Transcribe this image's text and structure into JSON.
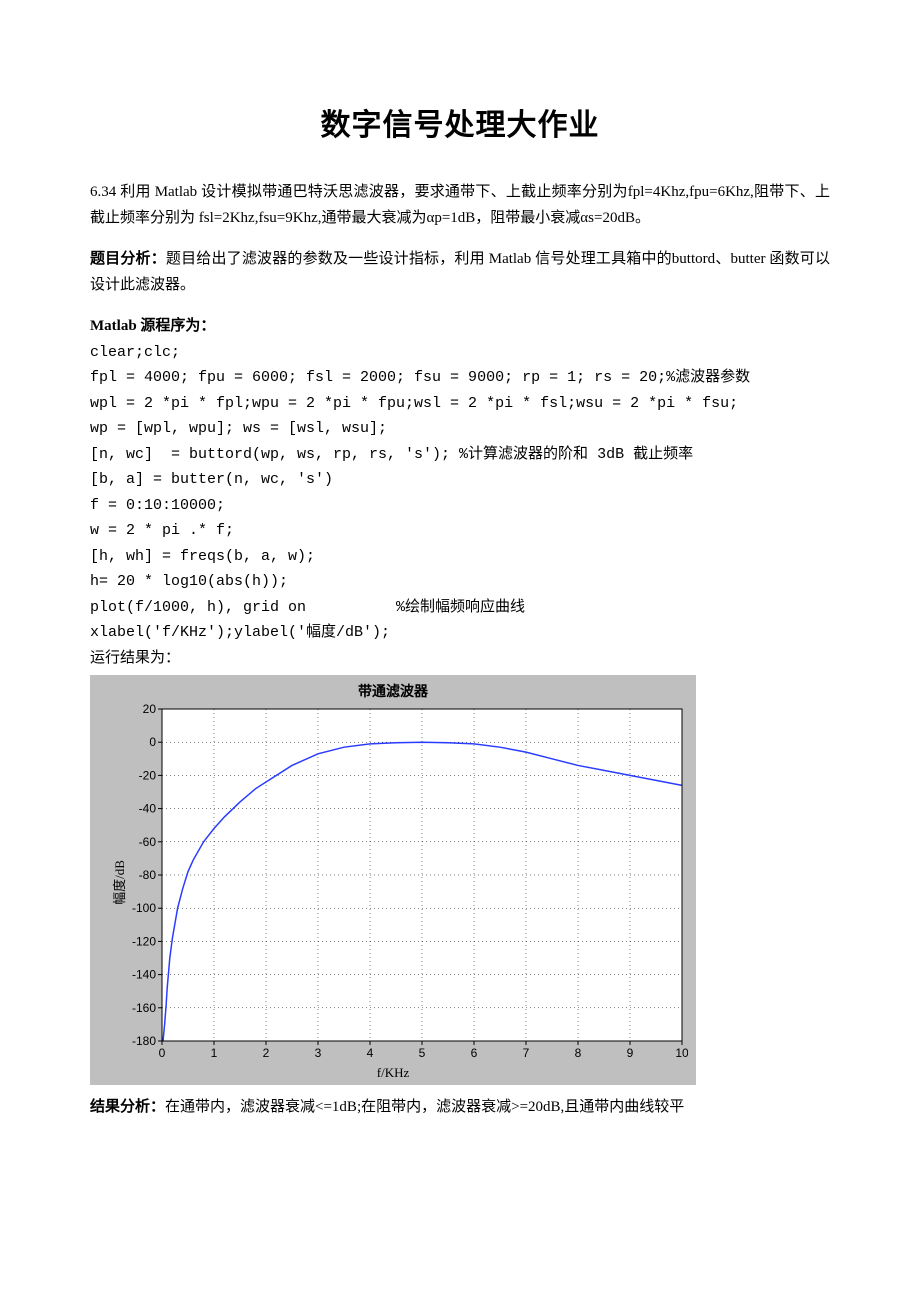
{
  "title": "数字信号处理大作业",
  "problem": "6.34   利用 Matlab 设计模拟带通巴特沃思滤波器，要求通带下、上截止频率分别为fpl=4Khz,fpu=6Khz,阻带下、上截止频率分别为 fsl=2Khz,fsu=9Khz,通带最大衰减为αp=1dB，阻带最小衰减αs=20dB。",
  "analysis_label": "题目分析：",
  "analysis_text": "题目给出了滤波器的参数及一些设计指标，利用 Matlab 信号处理工具箱中的buttord、butter 函数可以设计此滤波器。",
  "source_label": "Matlab 源程序为：",
  "code_lines": [
    "clear;clc;",
    "fpl = 4000; fpu = 6000; fsl = 2000; fsu = 9000; rp = 1; rs = 20;%滤波器参数",
    "wpl = 2 *pi * fpl;wpu = 2 *pi * fpu;wsl = 2 *pi * fsl;wsu = 2 *pi * fsu;",
    "wp = [wpl, wpu]; ws = [wsl, wsu];",
    "[n, wc]  = buttord(wp, ws, rp, rs, 's'); %计算滤波器的阶和 3dB 截止频率",
    "[b, a] = butter(n, wc, 's')",
    "f = 0:10:10000;",
    "w = 2 * pi .* f;",
    "[h, wh] = freqs(b, a, w);",
    "h= 20 * log10(abs(h));",
    "plot(f/1000, h), grid on          %绘制幅频响应曲线",
    "xlabel('f/KHz');ylabel('幅度/dB');",
    "运行结果为："
  ],
  "result_label": "结果分析：",
  "result_text": "在通带内，滤波器衰减<=1dB;在阻带内，滤波器衰减>=20dB,且通带内曲线较平",
  "chart_data": {
    "type": "line",
    "title": "带通滤波器",
    "xlabel": "f/KHz",
    "ylabel": "幅度/dB",
    "xlim": [
      0,
      10
    ],
    "ylim": [
      -180,
      20
    ],
    "xticks": [
      0,
      1,
      2,
      3,
      4,
      5,
      6,
      7,
      8,
      9,
      10
    ],
    "yticks": [
      20,
      0,
      -20,
      -40,
      -60,
      -80,
      -100,
      -120,
      -140,
      -160,
      -180
    ],
    "series": [
      {
        "name": "magnitude",
        "color": "#2a3cff",
        "x": [
          0.02,
          0.05,
          0.08,
          0.1,
          0.15,
          0.2,
          0.3,
          0.4,
          0.5,
          0.6,
          0.8,
          1.0,
          1.2,
          1.5,
          1.8,
          2.0,
          2.5,
          3.0,
          3.5,
          4.0,
          4.5,
          5.0,
          5.5,
          6.0,
          6.5,
          7.0,
          7.5,
          8.0,
          8.5,
          9.0,
          9.5,
          10.0
        ],
        "y": [
          -180,
          -170,
          -158,
          -148,
          -130,
          -118,
          -100,
          -88,
          -78,
          -71,
          -60,
          -52,
          -45,
          -36,
          -28,
          -24,
          -14,
          -7,
          -3,
          -1,
          -0.3,
          0,
          -0.3,
          -1,
          -3,
          -6,
          -10,
          -14,
          -17,
          -20,
          -23,
          -26
        ]
      }
    ]
  }
}
